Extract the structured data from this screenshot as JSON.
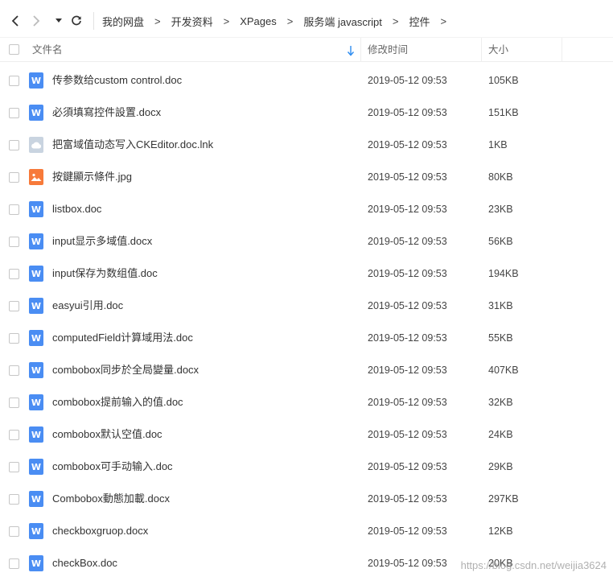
{
  "breadcrumb": [
    "我的网盘",
    "开发资料",
    "XPages",
    "服务端 javascript",
    "控件"
  ],
  "breadcrumb_separator": ">",
  "columns": {
    "name": "文件名",
    "modified": "修改时间",
    "size": "大小"
  },
  "files": [
    {
      "name": "传参数给custom control.doc",
      "modified": "2019-05-12 09:53",
      "size": "105KB",
      "icon": "doc"
    },
    {
      "name": "必須填寫控件設置.docx",
      "modified": "2019-05-12 09:53",
      "size": "151KB",
      "icon": "doc"
    },
    {
      "name": "把富域值动态写入CKEditor.doc.lnk",
      "modified": "2019-05-12 09:53",
      "size": "1KB",
      "icon": "lnk"
    },
    {
      "name": "按鍵顯示條件.jpg",
      "modified": "2019-05-12 09:53",
      "size": "80KB",
      "icon": "img"
    },
    {
      "name": "listbox.doc",
      "modified": "2019-05-12 09:53",
      "size": "23KB",
      "icon": "doc"
    },
    {
      "name": "input显示多域值.docx",
      "modified": "2019-05-12 09:53",
      "size": "56KB",
      "icon": "doc"
    },
    {
      "name": "input保存为数组值.doc",
      "modified": "2019-05-12 09:53",
      "size": "194KB",
      "icon": "doc"
    },
    {
      "name": "easyui引用.doc",
      "modified": "2019-05-12 09:53",
      "size": "31KB",
      "icon": "doc"
    },
    {
      "name": "computedField计算域用法.doc",
      "modified": "2019-05-12 09:53",
      "size": "55KB",
      "icon": "doc"
    },
    {
      "name": "combobox同步於全局變量.docx",
      "modified": "2019-05-12 09:53",
      "size": "407KB",
      "icon": "doc"
    },
    {
      "name": "combobox提前输入的值.doc",
      "modified": "2019-05-12 09:53",
      "size": "32KB",
      "icon": "doc"
    },
    {
      "name": "combobox默认空值.doc",
      "modified": "2019-05-12 09:53",
      "size": "24KB",
      "icon": "doc"
    },
    {
      "name": "combobox可手动输入.doc",
      "modified": "2019-05-12 09:53",
      "size": "29KB",
      "icon": "doc"
    },
    {
      "name": "Combobox動態加載.docx",
      "modified": "2019-05-12 09:53",
      "size": "297KB",
      "icon": "doc"
    },
    {
      "name": "checkboxgruop.docx",
      "modified": "2019-05-12 09:53",
      "size": "12KB",
      "icon": "doc"
    },
    {
      "name": "checkBox.doc",
      "modified": "2019-05-12 09:53",
      "size": "20KB",
      "icon": "doc"
    }
  ],
  "doc_icon_letter": "W",
  "watermark": "https://blog.csdn.net/weijia3624",
  "colors": {
    "doc_icon": "#4a8df3",
    "img_icon": "#f77a3a",
    "lnk_icon": "#c9d4e0",
    "sort_arrow": "#2d8cf0"
  }
}
